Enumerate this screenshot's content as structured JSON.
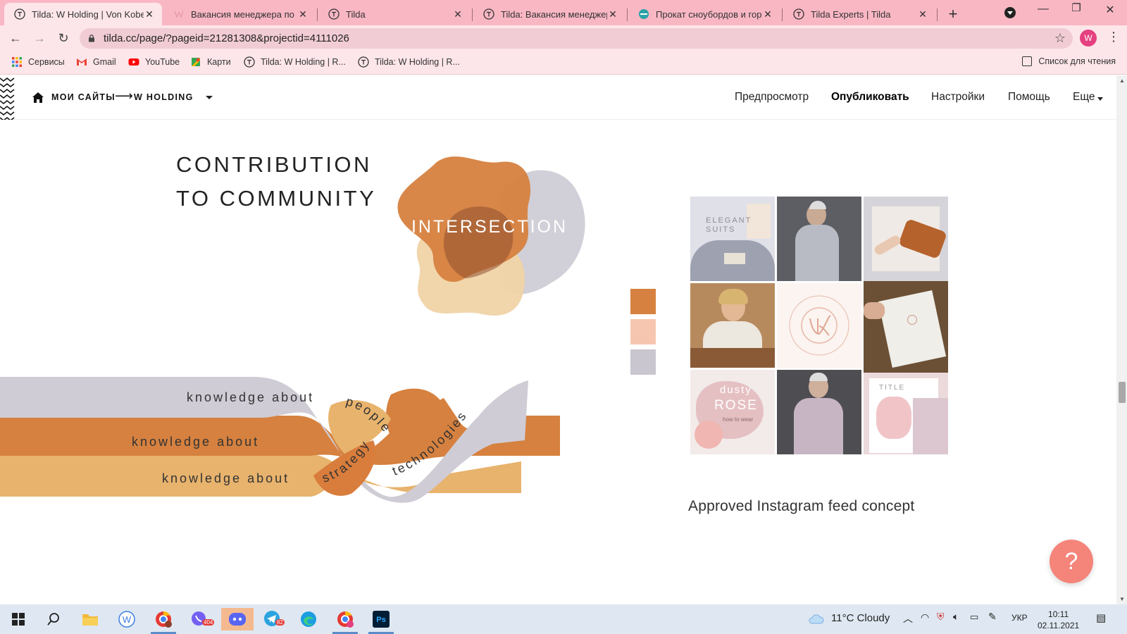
{
  "browser": {
    "tabs": [
      {
        "title": "Tilda: W Holding | Von Kobe",
        "active": true
      },
      {
        "title": "Вакансия менеджера по п",
        "active": false
      },
      {
        "title": "Tilda",
        "active": false
      },
      {
        "title": "Tilda: Вакансия менеджера",
        "active": false
      },
      {
        "title": "Прокат сноубордов и горн",
        "active": false
      },
      {
        "title": "Tilda Experts | Tilda",
        "active": false
      }
    ],
    "url": "tilda.cc/page/?pageid=21281308&projectid=4111026",
    "profile_initial": "W",
    "bookmarks": [
      "Сервисы",
      "Gmail",
      "YouTube",
      "Карти",
      "Tilda: W Holding | R...",
      "Tilda: W Holding | R..."
    ],
    "reading_list": "Список для чтения"
  },
  "tilda": {
    "breadcrumb_root": "МОИ САЙТЫ",
    "breadcrumb_project": "W HOLDING",
    "menu": {
      "preview": "Предпросмотр",
      "publish": "Опубликовать",
      "settings": "Настройки",
      "help": "Помощь",
      "more": "Еще"
    }
  },
  "content": {
    "title_line1": "CONTRIBUTION",
    "title_line2": "TO COMMUNITY",
    "blob_label": "INTERSECTION",
    "braid_labels": {
      "row1": "knowledge about",
      "row2": "knowledge about",
      "row3": "knowledge about",
      "people": "people",
      "strategy": "strategy",
      "technologies": "technologies"
    },
    "swatches": [
      "#d6813f",
      "#f7c6b0",
      "#c9c6d0"
    ],
    "insta_texts": {
      "elegant": "ELEGANT",
      "suits": "SUITS",
      "dusty": "dusty",
      "rose": "ROSE",
      "how_to_wear": "how to wear",
      "title": "TITLE"
    },
    "caption": "Approved Instagram feed concept",
    "help_symbol": "?"
  },
  "colors": {
    "orange": "#d6813f",
    "dark_orange": "#b85f28",
    "tan": "#e8b36d",
    "peach": "#f0cda0",
    "grey": "#cfccd5",
    "fab": "#f5847a"
  },
  "taskbar": {
    "weather": "11°C  Cloudy",
    "lang": "УКР",
    "time": "10:11",
    "date": "02.11.2021",
    "badge_viber": "404",
    "badge_telegram": "82"
  }
}
